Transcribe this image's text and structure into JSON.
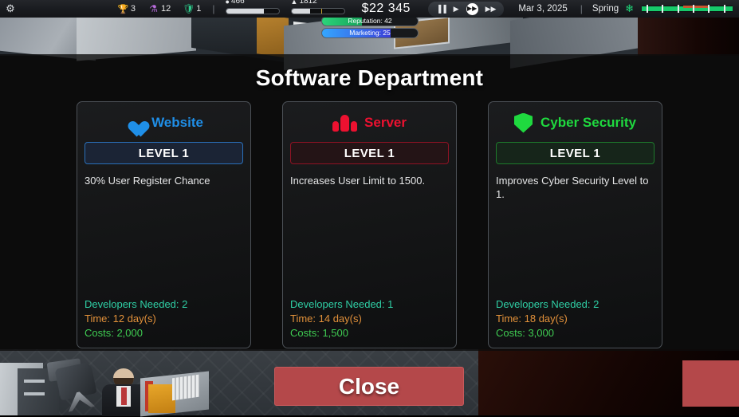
{
  "topbar": {
    "settings_icon": "gear-icon",
    "resources": [
      {
        "icon": "trophy-icon",
        "glyph": "♚",
        "color": "#e8c13a",
        "value": "3"
      },
      {
        "icon": "research-flask-icon",
        "glyph": "⚗",
        "color": "#b86cdc",
        "value": "12"
      },
      {
        "icon": "shield-icon",
        "glyph": "▼",
        "color": "#2fcf8e",
        "value": "1"
      }
    ],
    "divider": "|",
    "meters": [
      {
        "icon": "capacity-icon",
        "label": "466",
        "percent": 72,
        "tick": null
      },
      {
        "icon": "population-icon",
        "label": "1812",
        "percent": 36,
        "tick": 56
      }
    ],
    "money": "$22 345",
    "speed_controls": [
      {
        "name": "pause-button",
        "glyph": "▐▐",
        "active": false
      },
      {
        "name": "play-button",
        "glyph": "▶",
        "active": false
      },
      {
        "name": "fast-forward-button",
        "glyph": "▶▶",
        "active": true
      },
      {
        "name": "very-fast-forward-button",
        "glyph": "▶▶",
        "active": false
      }
    ],
    "date": "Mar 3, 2025",
    "divider2": "|",
    "season": "Spring",
    "season_icon": "flower-icon",
    "timeline": {
      "fill_percent": 100,
      "red_start_percent": 46,
      "red_width_percent": 27,
      "ticks": [
        5,
        22,
        39,
        56,
        73,
        90
      ]
    }
  },
  "status_bars": [
    {
      "name": "reputation-bar",
      "label": "Reputation: 42",
      "value": 42,
      "fill_percent": 42,
      "color_from": "#2bd47a",
      "color_to": "#17a35a"
    },
    {
      "name": "marketing-bar",
      "label": "Marketing: 25",
      "value": 25,
      "fill_percent": 72,
      "color_from": "#35a7ff",
      "color_to": "#3a3fd8"
    }
  ],
  "modal": {
    "title": "Software Department",
    "close_label": "Close",
    "cards": [
      {
        "name": "website",
        "icon": "heart-icon",
        "title": "Website",
        "title_color": "#1f8fe8",
        "border_color": "#2a6fb8",
        "level_label": "LEVEL 1",
        "level_bg": "#1b2435",
        "description": "30% User Register Chance",
        "developers": "Developers Needed: 2",
        "time": "Time: 12 day(s)",
        "costs": "Costs: 2,000"
      },
      {
        "name": "server",
        "icon": "server-people-icon",
        "title": "Server",
        "title_color": "#ec1130",
        "border_color": "#8f1324",
        "level_label": "LEVEL 1",
        "level_bg": "#241416",
        "description": "Increases User Limit to 1500.",
        "developers": "Developers Needed: 1",
        "time": "Time: 14 day(s)",
        "costs": "Costs: 1,500"
      },
      {
        "name": "cyber-security",
        "icon": "shield-icon",
        "title": "Cyber Security",
        "title_color": "#1fd93f",
        "border_color": "#1e7a2c",
        "level_label": "LEVEL 1",
        "level_bg": "#16251a",
        "description": "Improves Cyber Security Level to 1.",
        "developers": "Developers Needed: 2",
        "time": "Time: 18 day(s)",
        "costs": "Costs: 3,000"
      }
    ]
  }
}
